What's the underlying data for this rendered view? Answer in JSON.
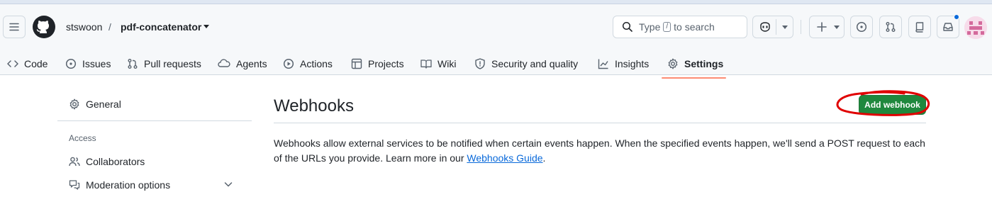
{
  "header": {
    "owner": "stswoon",
    "separator": "/",
    "repo": "pdf-concatenator",
    "search_prefix": "Type",
    "search_key": "/",
    "search_suffix": "to search"
  },
  "tabs": [
    {
      "label": "Code",
      "icon": "code-icon"
    },
    {
      "label": "Issues",
      "icon": "issue-icon"
    },
    {
      "label": "Pull requests",
      "icon": "pull-request-icon"
    },
    {
      "label": "Agents",
      "icon": "agent-icon"
    },
    {
      "label": "Actions",
      "icon": "play-icon"
    },
    {
      "label": "Projects",
      "icon": "table-icon"
    },
    {
      "label": "Wiki",
      "icon": "book-icon"
    },
    {
      "label": "Security and quality",
      "icon": "shield-icon"
    },
    {
      "label": "Insights",
      "icon": "graph-icon"
    },
    {
      "label": "Settings",
      "icon": "gear-icon",
      "active": true
    }
  ],
  "sidebar": {
    "general": "General",
    "access_heading": "Access",
    "collaborators": "Collaborators",
    "moderation": "Moderation options"
  },
  "main": {
    "title": "Webhooks",
    "add_button": "Add webhook",
    "description_1": "Webhooks allow external services to be notified when certain events happen. When the specified events happen, we'll send a POST request to each of the URLs you provide. Learn more in our ",
    "link_text": "Webhooks Guide",
    "description_2": "."
  },
  "colors": {
    "accent_green": "#1f883d",
    "link_blue": "#0969da",
    "tab_underline": "#fd8c73",
    "annotation_red": "#e00000"
  }
}
